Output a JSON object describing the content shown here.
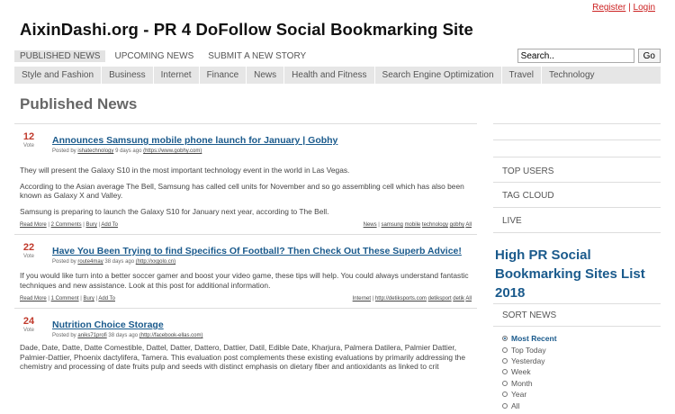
{
  "auth": {
    "register": "Register",
    "sep": "|",
    "login": "Login"
  },
  "site_title": "AixinDashi.org - PR 4 DoFollow Social Bookmarking Site",
  "topnav": [
    "PUBLISHED NEWS",
    "UPCOMING NEWS",
    "SUBMIT A NEW STORY"
  ],
  "search": {
    "value": "Search..",
    "button": "Go"
  },
  "categories": [
    "Style and Fashion",
    "Business",
    "Internet",
    "Finance",
    "News",
    "Health and Fitness",
    "Search Engine Optimization",
    "Travel",
    "Technology"
  ],
  "page_heading": "Published News",
  "stories": [
    {
      "votes": "12",
      "vote_label": "Vote",
      "title": "Announces Samsung mobile phone launch for January | Gobhy",
      "meta_prefix": "Posted by",
      "author": "ishatechnology",
      "meta_time": "9 days ago",
      "source": "(https://www.gobhy.com)",
      "body": [
        "They will present the Galaxy S10 in the most important technology event in the world in Las Vegas.",
        "According to the Asian average The Bell, Samsung has called cell units for November and so go assembling cell which has also been known as Galaxy X and Valley.",
        "Samsung is preparing to launch the Galaxy S10 for January next year, according to The Bell."
      ],
      "actions": [
        "Read More",
        "2 Comments",
        "Bury",
        "Add To"
      ],
      "tags": [
        "News",
        "samsung",
        "mobile",
        "technology",
        "gobhy",
        "All"
      ]
    },
    {
      "votes": "22",
      "vote_label": "Vote",
      "title": "Have You Been Trying to find Specifics Of Football? Then Check Out These Superb Advice!",
      "meta_prefix": "Posted by",
      "author": "route4may",
      "meta_time": "38 days ago",
      "source": "(http://xxgolo.cn)",
      "body": [
        "If you would like turn into a better soccer gamer and boost your video game, these tips will help. You could always understand fantastic techniques and new assistance. Look at this post for additional information."
      ],
      "actions": [
        "Read More",
        "1 Comment",
        "Bury",
        "Add To"
      ],
      "tags": [
        "Internet",
        "http://detiksports.com",
        "detiksport",
        "detik",
        "All"
      ]
    },
    {
      "votes": "24",
      "vote_label": "Vote",
      "title": "Nutrition Choice Storage",
      "meta_prefix": "Posted by",
      "author": "aniks71profi",
      "meta_time": "38 days ago",
      "source": "(http://facebook-ellas.com)",
      "body": [
        "Dade, Date, Datte, Datte Comestible, Dattel, Datter, Dattero, Dattier, Datil, Edible Date, Kharjura, Palmera Datilera, Palmier Dattier, Palmier-Dattier, Phoenix dactylifera, Tamera. This evaluation post complements these existing evaluations by primarily addressing the chemistry and processing of date fruits pulp and seeds with distinct emphasis on dietary fiber and antioxidants as linked to crit"
      ],
      "actions": [],
      "tags": []
    }
  ],
  "sidebar": {
    "links": [
      "TOP USERS",
      "TAG CLOUD",
      "LIVE"
    ],
    "big_heading": "High PR Social Bookmarking Sites List 2018",
    "sort_heading": "SORT NEWS",
    "sort_options": [
      "Most Recent",
      "Top Today",
      "Yesterday",
      "Week",
      "Month",
      "Year",
      "All"
    ],
    "sort_selected": "Most Recent"
  }
}
